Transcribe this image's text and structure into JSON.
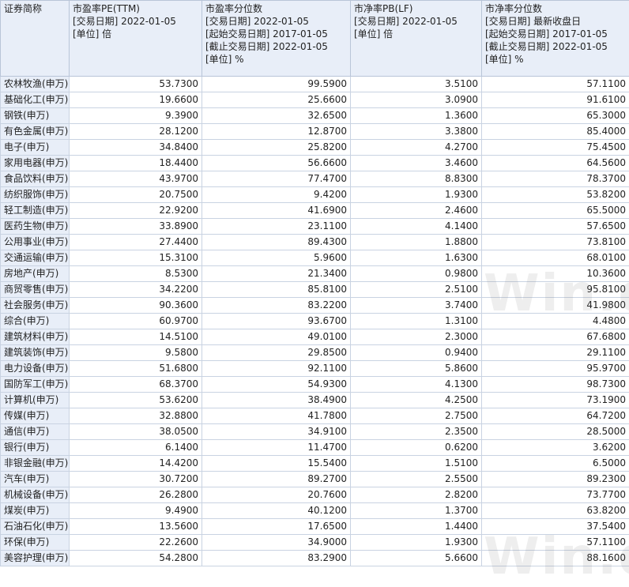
{
  "headers": [
    {
      "lines": [
        "证券简称"
      ]
    },
    {
      "lines": [
        "市盈率PE(TTM)",
        "[交易日期] 2022-01-05",
        "[单位] 倍"
      ]
    },
    {
      "lines": [
        "市盈率分位数",
        "[交易日期] 2022-01-05",
        "[起始交易日期] 2017-01-05",
        "[截止交易日期] 2022-01-05",
        "[单位] %"
      ]
    },
    {
      "lines": [
        "市净率PB(LF)",
        "[交易日期] 2022-01-05",
        "[单位] 倍"
      ]
    },
    {
      "lines": [
        "市净率分位数",
        "[交易日期] 最新收盘日",
        "[起始交易日期] 2017-01-05",
        "[截止交易日期] 2022-01-05",
        "[单位] %"
      ]
    }
  ],
  "rows": [
    [
      "农林牧渔(申万)",
      "53.7300",
      "99.5900",
      "3.5100",
      "57.1100"
    ],
    [
      "基础化工(申万)",
      "19.6600",
      "25.6600",
      "3.0900",
      "91.6100"
    ],
    [
      "钢铁(申万)",
      "9.3900",
      "32.6500",
      "1.3600",
      "65.3000"
    ],
    [
      "有色金属(申万)",
      "28.1200",
      "12.8700",
      "3.3800",
      "85.4000"
    ],
    [
      "电子(申万)",
      "34.8400",
      "25.8200",
      "4.2700",
      "75.4500"
    ],
    [
      "家用电器(申万)",
      "18.4400",
      "56.6600",
      "3.4600",
      "64.5600"
    ],
    [
      "食品饮料(申万)",
      "43.9700",
      "77.4700",
      "8.8300",
      "78.3700"
    ],
    [
      "纺织服饰(申万)",
      "20.7500",
      "9.4200",
      "1.9300",
      "53.8200"
    ],
    [
      "轻工制造(申万)",
      "22.9200",
      "41.6900",
      "2.4600",
      "65.5000"
    ],
    [
      "医药生物(申万)",
      "33.8900",
      "23.1100",
      "4.1400",
      "57.6500"
    ],
    [
      "公用事业(申万)",
      "27.4400",
      "89.4300",
      "1.8800",
      "73.8100"
    ],
    [
      "交通运输(申万)",
      "15.3100",
      "5.9600",
      "1.6300",
      "68.0100"
    ],
    [
      "房地产(申万)",
      "8.5300",
      "21.3400",
      "0.9800",
      "10.3600"
    ],
    [
      "商贸零售(申万)",
      "34.2200",
      "85.8100",
      "2.5100",
      "95.8100"
    ],
    [
      "社会服务(申万)",
      "90.3600",
      "83.2200",
      "3.7400",
      "41.9800"
    ],
    [
      "综合(申万)",
      "60.9700",
      "93.6700",
      "1.3100",
      "4.4800"
    ],
    [
      "建筑材料(申万)",
      "14.5100",
      "49.0100",
      "2.3000",
      "67.6800"
    ],
    [
      "建筑装饰(申万)",
      "9.5800",
      "29.8500",
      "0.9400",
      "29.1100"
    ],
    [
      "电力设备(申万)",
      "51.6800",
      "92.1100",
      "5.8600",
      "95.9700"
    ],
    [
      "国防军工(申万)",
      "68.3700",
      "54.9300",
      "4.1300",
      "98.7300"
    ],
    [
      "计算机(申万)",
      "53.6200",
      "38.4900",
      "4.2500",
      "73.1900"
    ],
    [
      "传媒(申万)",
      "32.8800",
      "41.7800",
      "2.7500",
      "64.7200"
    ],
    [
      "通信(申万)",
      "38.0500",
      "34.9100",
      "2.3500",
      "28.5000"
    ],
    [
      "银行(申万)",
      "6.1400",
      "11.4700",
      "0.6200",
      "3.6200"
    ],
    [
      "非银金融(申万)",
      "14.4200",
      "15.5400",
      "1.5100",
      "6.5000"
    ],
    [
      "汽车(申万)",
      "30.7200",
      "89.2700",
      "2.5500",
      "89.2300"
    ],
    [
      "机械设备(申万)",
      "26.2800",
      "20.7600",
      "2.8200",
      "73.7700"
    ],
    [
      "煤炭(申万)",
      "9.4900",
      "40.1200",
      "1.3700",
      "63.8200"
    ],
    [
      "石油石化(申万)",
      "13.5600",
      "17.6500",
      "1.4400",
      "37.5400"
    ],
    [
      "环保(申万)",
      "22.2600",
      "34.9000",
      "1.9300",
      "57.1100"
    ],
    [
      "美容护理(申万)",
      "54.2800",
      "83.2900",
      "5.6600",
      "88.1600"
    ]
  ],
  "watermarks": [
    "Win.d",
    "Win.d"
  ]
}
